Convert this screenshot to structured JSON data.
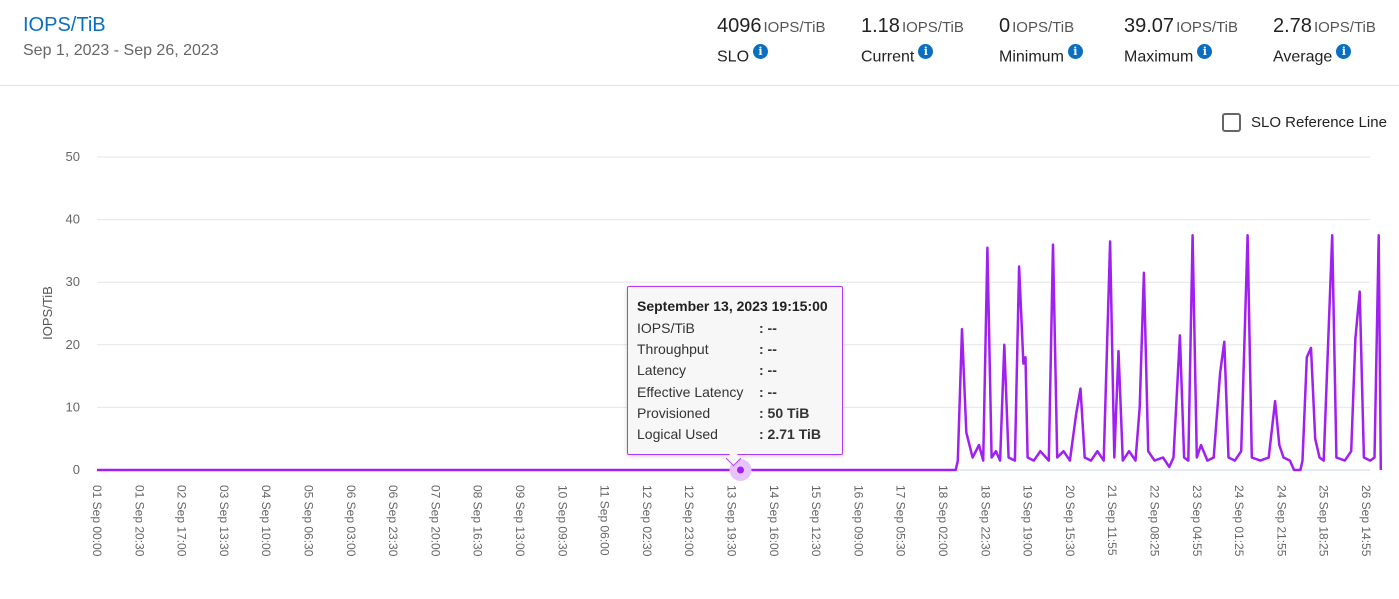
{
  "header": {
    "title": "IOPS/TiB",
    "date_range": "Sep 1, 2023 - Sep 26, 2023"
  },
  "stats": [
    {
      "value": "4096",
      "unit": "IOPS/TiB",
      "label": "SLO",
      "icon": "info-icon"
    },
    {
      "value": "1.18",
      "unit": "IOPS/TiB",
      "label": "Current",
      "icon": "info-icon"
    },
    {
      "value": "0",
      "unit": "IOPS/TiB",
      "label": "Minimum",
      "icon": "info-icon"
    },
    {
      "value": "39.07",
      "unit": "IOPS/TiB",
      "label": "Maximum",
      "icon": "info-icon"
    },
    {
      "value": "2.78",
      "unit": "IOPS/TiB",
      "label": "Average",
      "icon": "info-icon"
    }
  ],
  "slo_reference_line": {
    "label": "SLO Reference Line",
    "checked": false
  },
  "tooltip": {
    "title": "September 13, 2023 19:15:00",
    "rows": [
      {
        "key": "IOPS/TiB",
        "value": ": --"
      },
      {
        "key": "Throughput",
        "value": ": --"
      },
      {
        "key": "Latency",
        "value": ": --"
      },
      {
        "key": "Effective Latency",
        "value": ": --"
      },
      {
        "key": "Provisioned",
        "value": ": 50 TiB"
      },
      {
        "key": "Logical Used",
        "value": ": 2.71 TiB"
      }
    ]
  },
  "colors": {
    "line": "#a020f0",
    "accent": "#0a6fc2",
    "hover": "#e6c4fb"
  },
  "chart_data": {
    "type": "line",
    "title": "IOPS/TiB",
    "xlabel": "",
    "ylabel": "IOPS/TiB",
    "ylim": [
      0,
      50
    ],
    "yticks": [
      0,
      10,
      20,
      30,
      40,
      50
    ],
    "grid": true,
    "x_tick_labels": [
      "01 Sep 00:00",
      "01 Sep 20:30",
      "02 Sep 17:00",
      "03 Sep 13:30",
      "04 Sep 10:00",
      "05 Sep 06:30",
      "06 Sep 03:00",
      "06 Sep 23:30",
      "07 Sep 20:00",
      "08 Sep 16:30",
      "09 Sep 13:00",
      "10 Sep 09:30",
      "11 Sep 06:00",
      "12 Sep 02:30",
      "12 Sep 23:00",
      "13 Sep 19:30",
      "14 Sep 16:00",
      "15 Sep 12:30",
      "16 Sep 09:00",
      "17 Sep 05:30",
      "18 Sep 02:00",
      "18 Sep 22:30",
      "19 Sep 19:00",
      "20 Sep 15:30",
      "21 Sep 11:55",
      "22 Sep 08:25",
      "23 Sep 04:55",
      "24 Sep 01:25",
      "24 Sep 21:55",
      "25 Sep 18:25",
      "26 Sep 14:55"
    ],
    "series": [
      {
        "name": "IOPS/TiB",
        "note": "x in tick-index units (0 = 01 Sep 00:00, 30 = 26 Sep 14:55); zero from start until ~18 Sep 02:00, then baseline ~1-3 with spikes",
        "points": [
          [
            0,
            0
          ],
          [
            20.3,
            0
          ],
          [
            20.35,
            1.5
          ],
          [
            20.45,
            22.5
          ],
          [
            20.55,
            6
          ],
          [
            20.7,
            2
          ],
          [
            20.85,
            4
          ],
          [
            20.95,
            1.5
          ],
          [
            21.05,
            35.5
          ],
          [
            21.15,
            2
          ],
          [
            21.25,
            3
          ],
          [
            21.35,
            1.5
          ],
          [
            21.45,
            20
          ],
          [
            21.55,
            2
          ],
          [
            21.7,
            1.5
          ],
          [
            21.8,
            32.5
          ],
          [
            21.9,
            17
          ],
          [
            21.95,
            18
          ],
          [
            22.0,
            2
          ],
          [
            22.15,
            1.5
          ],
          [
            22.3,
            3
          ],
          [
            22.5,
            1.5
          ],
          [
            22.6,
            36
          ],
          [
            22.7,
            2
          ],
          [
            22.85,
            3
          ],
          [
            23.0,
            1.5
          ],
          [
            23.15,
            9
          ],
          [
            23.25,
            13
          ],
          [
            23.35,
            2
          ],
          [
            23.5,
            1.5
          ],
          [
            23.65,
            3
          ],
          [
            23.8,
            1.5
          ],
          [
            23.95,
            36.5
          ],
          [
            24.05,
            2
          ],
          [
            24.15,
            19
          ],
          [
            24.25,
            1.5
          ],
          [
            24.4,
            3
          ],
          [
            24.55,
            1.5
          ],
          [
            24.65,
            10
          ],
          [
            24.75,
            31.5
          ],
          [
            24.85,
            3
          ],
          [
            25.0,
            1.5
          ],
          [
            25.2,
            2
          ],
          [
            25.35,
            0.5
          ],
          [
            25.45,
            2
          ],
          [
            25.6,
            21.5
          ],
          [
            25.7,
            2
          ],
          [
            25.8,
            1.5
          ],
          [
            25.9,
            37.5
          ],
          [
            26.0,
            2
          ],
          [
            26.1,
            4
          ],
          [
            26.25,
            1.5
          ],
          [
            26.4,
            2
          ],
          [
            26.55,
            15.5
          ],
          [
            26.65,
            20.5
          ],
          [
            26.75,
            2
          ],
          [
            26.9,
            1.5
          ],
          [
            27.05,
            3
          ],
          [
            27.2,
            37.5
          ],
          [
            27.3,
            2
          ],
          [
            27.5,
            1.5
          ],
          [
            27.7,
            2
          ],
          [
            27.85,
            11
          ],
          [
            27.95,
            4
          ],
          [
            28.05,
            2
          ],
          [
            28.2,
            1.5
          ],
          [
            28.3,
            0
          ],
          [
            28.45,
            0
          ],
          [
            28.5,
            1.5
          ],
          [
            28.6,
            18
          ],
          [
            28.7,
            19.5
          ],
          [
            28.8,
            5
          ],
          [
            28.9,
            2
          ],
          [
            29.0,
            1.5
          ],
          [
            29.2,
            37.5
          ],
          [
            29.3,
            2
          ],
          [
            29.5,
            1.5
          ],
          [
            29.65,
            3
          ],
          [
            29.75,
            21
          ],
          [
            29.85,
            28.5
          ],
          [
            29.95,
            2
          ],
          [
            30.1,
            1.5
          ],
          [
            30.2,
            2
          ],
          [
            30.3,
            37.5
          ],
          [
            30.35,
            0
          ]
        ]
      }
    ],
    "hover": {
      "x_label": "13 Sep 19:15",
      "value": 0
    }
  }
}
